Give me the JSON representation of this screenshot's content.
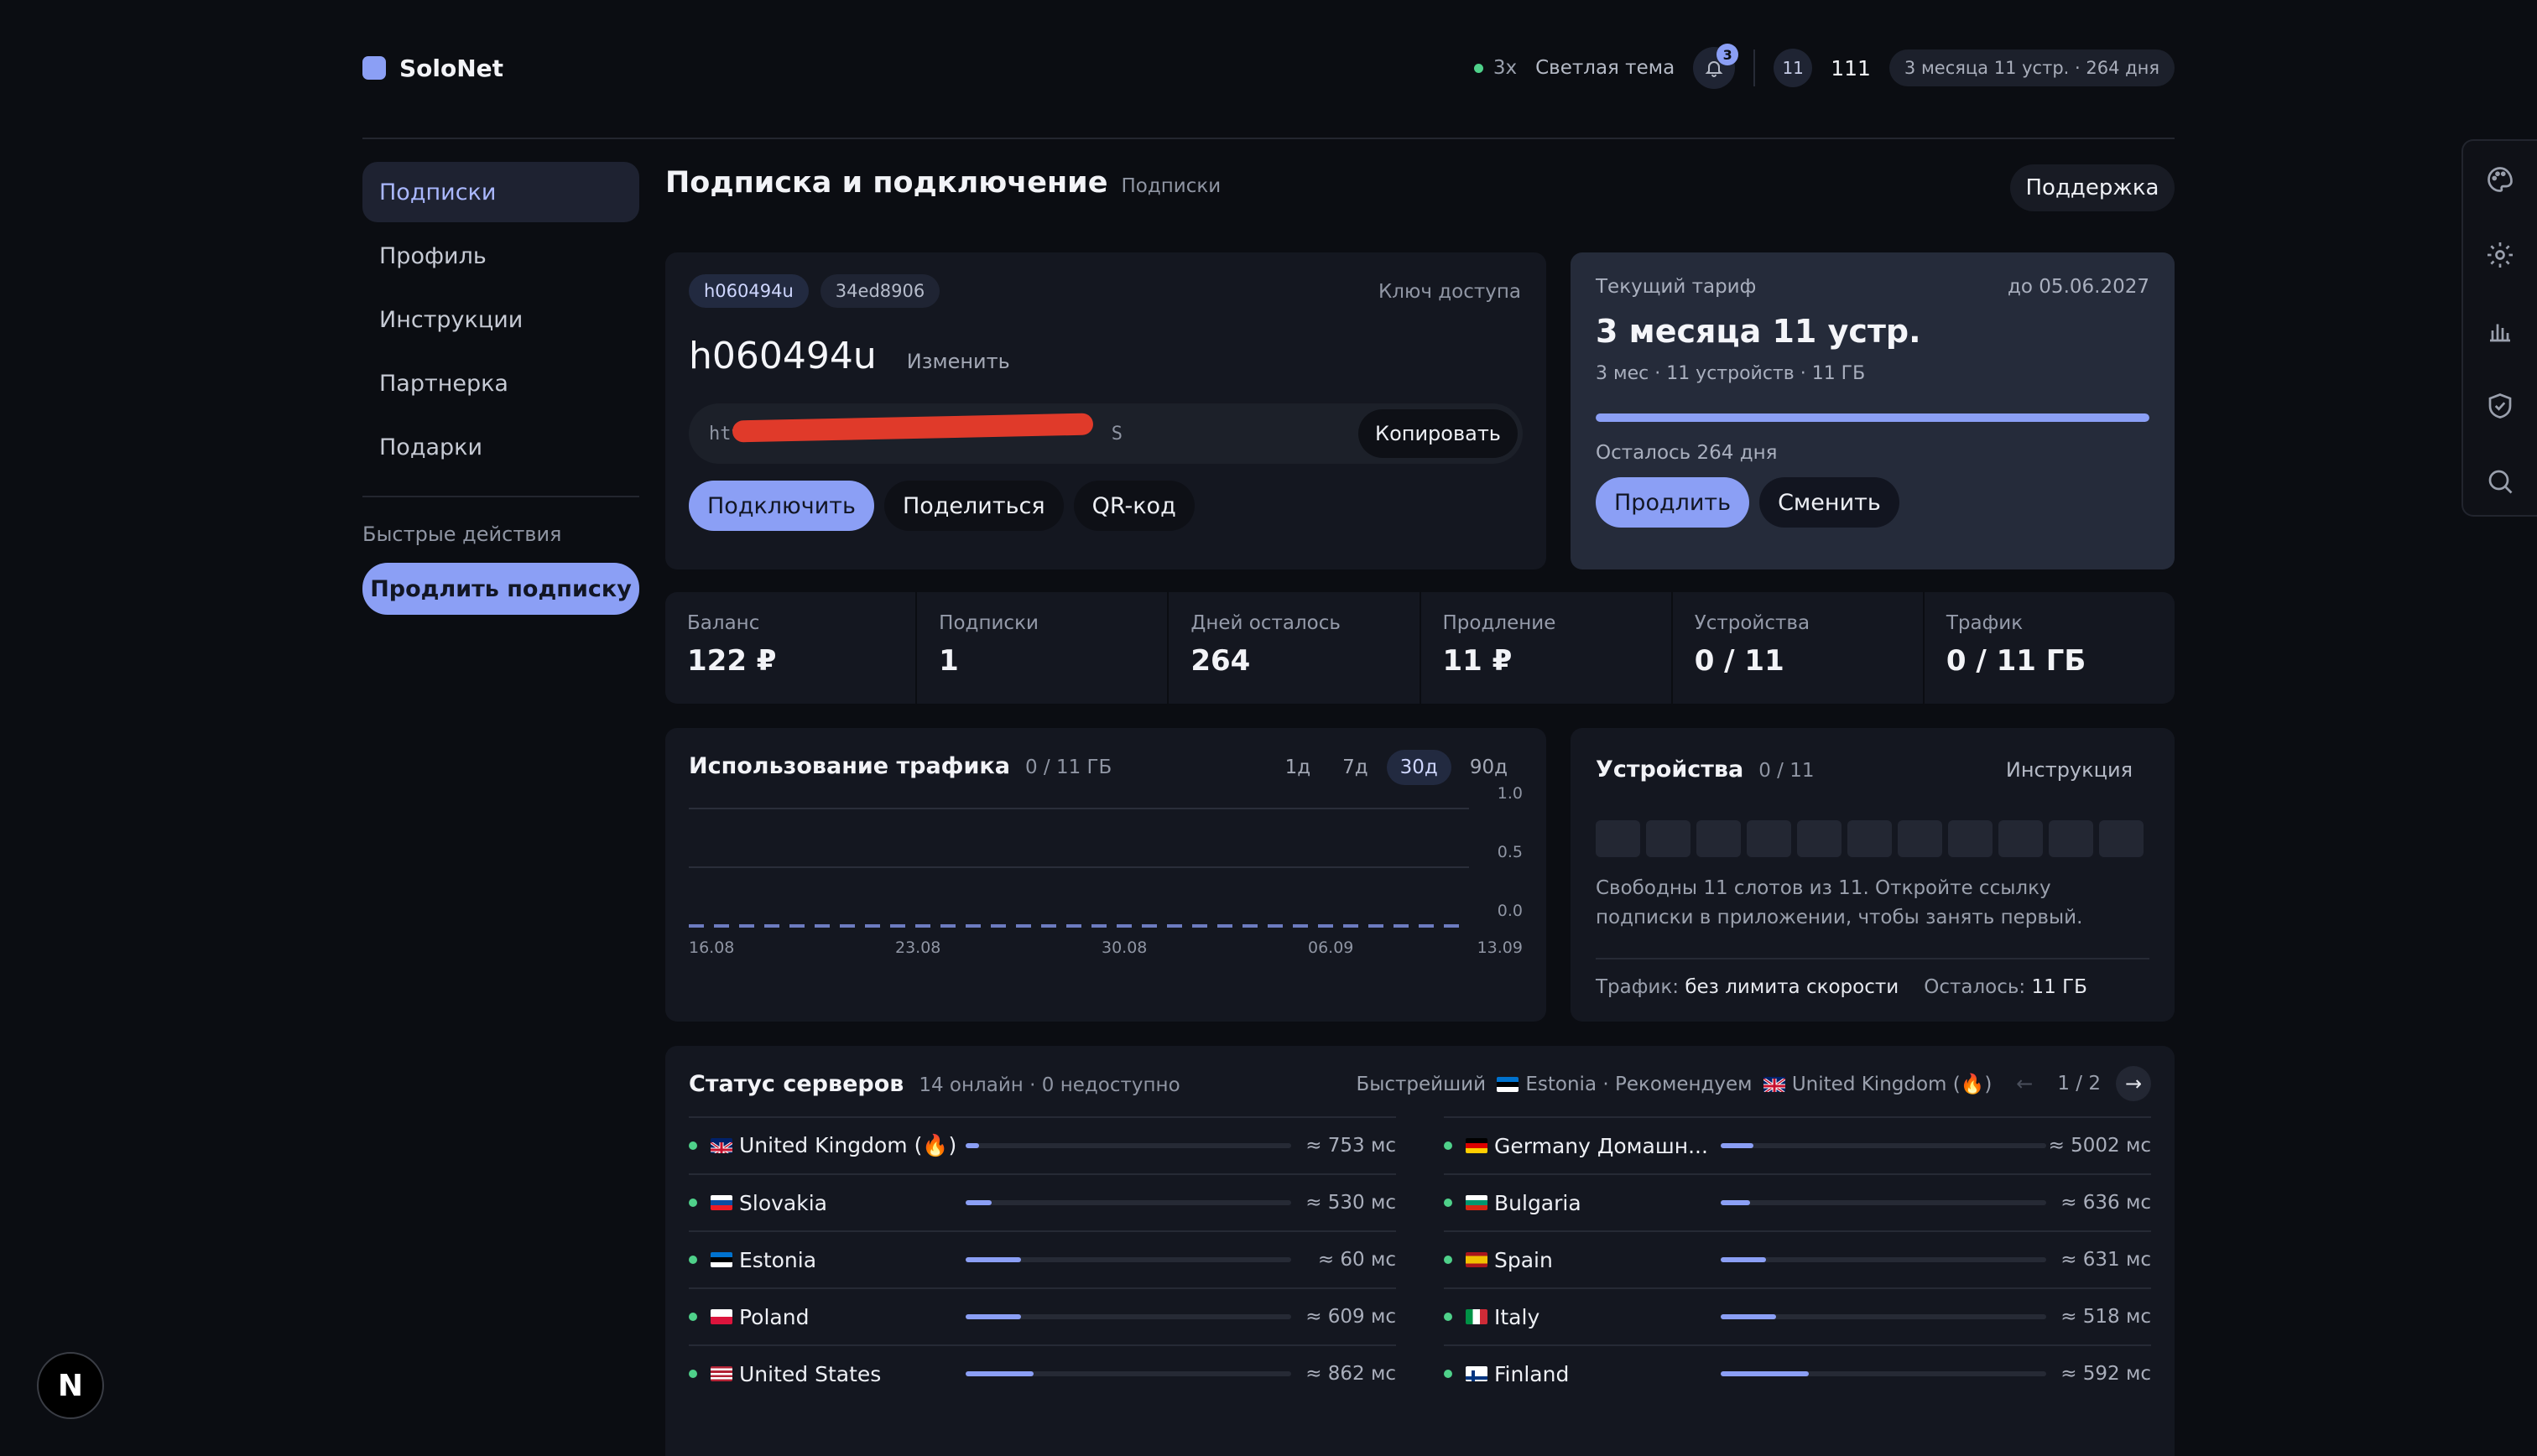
{
  "header": {
    "brand": "SoloNet",
    "speed": "3x",
    "theme_label": "Светлая тема",
    "notifications_count": "3",
    "avatar_text": "11",
    "user": "111",
    "plan_chip": "3 месяца 11 устр. · 264 дня"
  },
  "sidebar": {
    "items": [
      {
        "label": "Подписки",
        "active": true
      },
      {
        "label": "Профиль"
      },
      {
        "label": "Инструкции"
      },
      {
        "label": "Партнерка"
      },
      {
        "label": "Подарки"
      }
    ],
    "quick_title": "Быстрые действия",
    "quick_button": "Продлить подписку"
  },
  "page": {
    "title": "Подписка и подключение",
    "subtitle": "Подписки",
    "support": "Поддержка"
  },
  "access": {
    "tags": [
      "h060494u",
      "34ed8906"
    ],
    "key_label": "Ключ доступа",
    "username": "h060494u",
    "edit": "Изменить",
    "link_start": "htt",
    "link_end": "S",
    "copy": "Копировать",
    "actions": [
      "Подключить",
      "Поделиться",
      "QR-код"
    ]
  },
  "plan": {
    "label": "Текущий тариф",
    "until": "до 05.06.2027",
    "name": "3 месяца 11 устр.",
    "meta": "3 мес · 11 устройств · 11 ГБ",
    "progress_pct": 100,
    "left": "Осталось 264 дня",
    "extend": "Продлить",
    "change": "Сменить"
  },
  "stats": [
    {
      "label": "Баланс",
      "value": "122 ₽"
    },
    {
      "label": "Подписки",
      "value": "1"
    },
    {
      "label": "Дней осталось",
      "value": "264"
    },
    {
      "label": "Продление",
      "value": "11 ₽"
    },
    {
      "label": "Устройства",
      "value": "0 / 11"
    },
    {
      "label": "Трафик",
      "value": "0 / 11 ГБ"
    }
  ],
  "traffic": {
    "title": "Использование трафика",
    "subtitle": "0 / 11 ГБ",
    "ranges": [
      "1д",
      "7д",
      "30д",
      "90д"
    ],
    "active_range": "30д"
  },
  "chart_data": {
    "type": "line",
    "x_ticks": [
      "16.08",
      "23.08",
      "30.08",
      "06.09",
      "13.09"
    ],
    "y_ticks": [
      "1.0",
      "0.5",
      "0.0"
    ],
    "ylim": [
      0,
      1
    ],
    "series": [
      {
        "values": [
          0,
          0,
          0,
          0,
          0,
          0,
          0,
          0,
          0,
          0,
          0,
          0,
          0,
          0,
          0,
          0,
          0,
          0,
          0,
          0,
          0,
          0,
          0,
          0,
          0,
          0,
          0,
          0,
          0,
          0
        ]
      }
    ]
  },
  "devices": {
    "title": "Устройства",
    "count": "0 / 11",
    "instructions": "Инструкция",
    "slots_total": 11,
    "description": "Свободны 11 слотов из 11. Откройте ссылку подписки в приложении, чтобы занять первый.",
    "traffic_label": "Трафик:",
    "traffic_value": "без лимита скорости",
    "left_label": "Осталось:",
    "left_value": "11 ГБ"
  },
  "servers": {
    "title": "Статус серверов",
    "subtitle": "14 онлайн · 0 недоступно",
    "fastest_label": "Быстрейший",
    "fastest": "Estonia",
    "recommend_label": "Рекомендуем",
    "recommend": "United Kingdom (🔥)",
    "page": "1 / 2",
    "left": [
      {
        "name": "United Kingdom (🔥)",
        "flag": "gb",
        "ping": "≈ 753 мс",
        "load": 0.04
      },
      {
        "name": "Slovakia",
        "flag": "sk",
        "ping": "≈ 530 мс",
        "load": 0.08
      },
      {
        "name": "Estonia",
        "flag": "ee",
        "ping": "≈ 60 мс",
        "load": 0.17
      },
      {
        "name": "Poland",
        "flag": "pl",
        "ping": "≈ 609 мс",
        "load": 0.17
      },
      {
        "name": "United States",
        "flag": "us",
        "ping": "≈ 862 мс",
        "load": 0.21
      }
    ],
    "right": [
      {
        "name": "Germany Домашн...",
        "flag": "de",
        "ping": "≈ 5002 мс",
        "load": 0.1
      },
      {
        "name": "Bulgaria",
        "flag": "bg",
        "ping": "≈ 636 мс",
        "load": 0.09
      },
      {
        "name": "Spain",
        "flag": "es",
        "ping": "≈ 631 мс",
        "load": 0.14
      },
      {
        "name": "Italy",
        "flag": "it",
        "ping": "≈ 518 мс",
        "load": 0.17
      },
      {
        "name": "Finland",
        "flag": "fi",
        "ping": "≈ 592 мс",
        "load": 0.27
      }
    ]
  },
  "colors": {
    "accent": "#8b9ff5",
    "online": "#4fd18a",
    "background": "#0b0d12",
    "card": "#141720"
  },
  "badge": "N"
}
